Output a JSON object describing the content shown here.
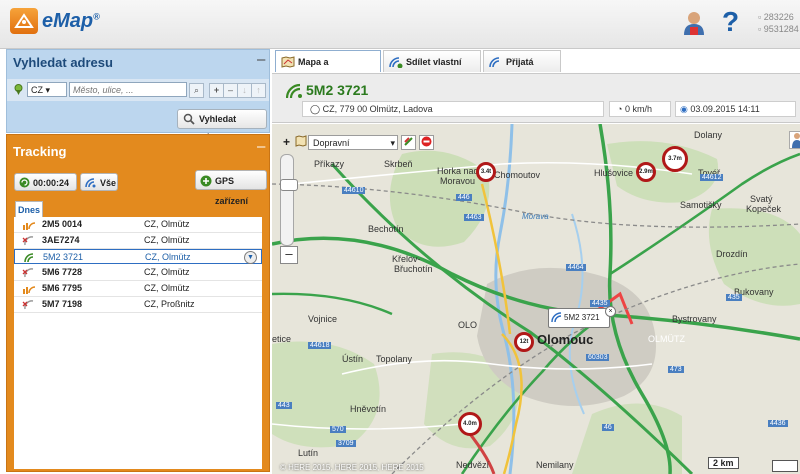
{
  "app": {
    "logo_text": "eMap",
    "logo_mark": "®",
    "stat1": "283226",
    "stat2": "9531284"
  },
  "search": {
    "title": "Vyhledat adresu",
    "collapse": "–",
    "country": "CZ",
    "address_placeholder": "Město, ulice, ...",
    "button_label": "Vyhledat adresu"
  },
  "tracking": {
    "title": "Tracking",
    "collapse": "–",
    "timer": "00:00:24",
    "all_label": "Vše",
    "gps_label": "GPS zařízení",
    "tab_label": "Dnes",
    "vehicles": [
      {
        "name": "2M5 0014",
        "location": "CZ, Olmütz",
        "status": "moving"
      },
      {
        "name": "3AE7274",
        "location": "CZ, Olmütz",
        "status": "offline"
      },
      {
        "name": "5M2 3721",
        "location": "CZ, Olmütz",
        "status": "selected"
      },
      {
        "name": "5M6 7728",
        "location": "CZ, Olmütz",
        "status": "offline"
      },
      {
        "name": "5M6 7795",
        "location": "CZ, Olmütz",
        "status": "moving"
      },
      {
        "name": "5M7 7198",
        "location": "CZ, Proßnitz",
        "status": "offline"
      }
    ]
  },
  "tabs": {
    "map": "Mapa a podrobnosti",
    "share": "Sdílet vlastní vozy",
    "received": "Přijatá sdílení"
  },
  "vehicle": {
    "title": "5M2 3721",
    "address": "CZ, 779 00 Olmütz, Ladova",
    "speed": "0 km/h",
    "timestamp": "03.09.2015 14:11"
  },
  "map": {
    "layer": "Dopravní",
    "zoom_in": "+",
    "zoom_out": "–",
    "popup_label": "5M2 3721",
    "popup_close": "×",
    "scale": "2 km",
    "copyright": "© HERE 2015, HERE 2015, HERE 2015",
    "places": {
      "prikazy": "Příkazy",
      "skrben": "Skrbeň",
      "horka": "Horka nad",
      "moravou": "Moravou",
      "chomoutov": "Chomoutov",
      "hlusovice": "Hlušovice",
      "tover": "Tovéř",
      "dolany": "Dolany",
      "samotisky": "Samotišky",
      "svaty": "Svatý",
      "kopecek": "Kopeček",
      "drozdin": "Drozdín",
      "bukovany": "Bukovany",
      "bystrovany": "Bystrovany",
      "olomouc": "Olomouc",
      "olmutz": "OLMÜTZ",
      "vojnice": "Vojnice",
      "olo": "OLO",
      "topolany": "Topolany",
      "ustin": "Ústín",
      "hnevotin": "Hněvotín",
      "lutin": "Lutín",
      "nedvezi": "Nedvězí",
      "nemilany": "Nemilany",
      "krelov": "Křelov-",
      "brehotin": "Břuchotín",
      "bechotin": "Bechotín",
      "ne": "etice",
      "morava": "Morava"
    },
    "restrictions": {
      "r1": "3.4t",
      "r2": "2.9m",
      "r3": "3.7m",
      "r4": "12t",
      "r5": "4.0m"
    },
    "road_numbers": {
      "n1": "44610",
      "n2": "4463",
      "n3": "446",
      "n4": "4464",
      "n5": "4435",
      "n6": "44618",
      "n7": "35",
      "n8": "570",
      "n9": "3709",
      "n10": "443",
      "n11": "44612",
      "n12": "60303",
      "n13": "46",
      "n14": "435",
      "n15": "4436",
      "n16": "473"
    }
  },
  "colors": {
    "accent": "#1d5fa8",
    "tracking_bg": "#e38a1e",
    "search_bg": "#bcd6ee",
    "vehicle_green": "#2b7a1e"
  }
}
